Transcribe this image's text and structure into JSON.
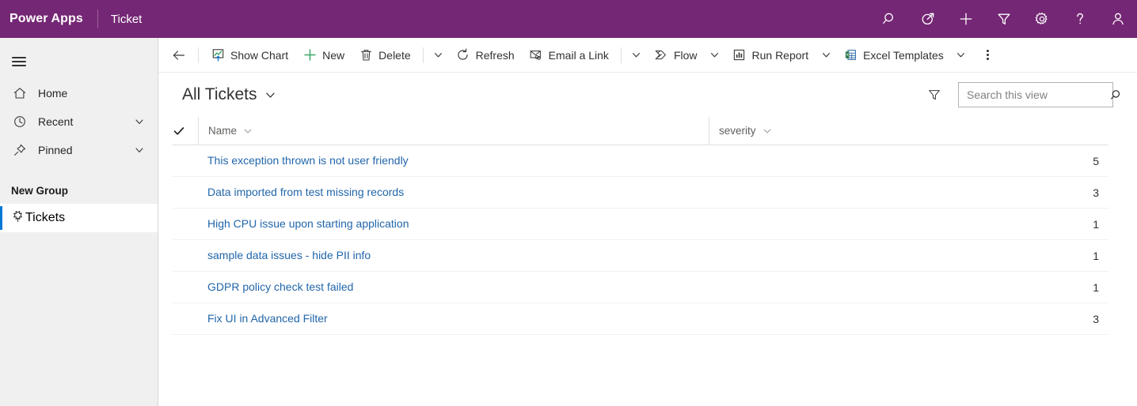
{
  "header": {
    "brand": "Power Apps",
    "app_name": "Ticket",
    "background_color": "#742774",
    "icons": [
      {
        "name": "search-icon",
        "label": "Search"
      },
      {
        "name": "diagnostics-icon",
        "label": "Diagnostics"
      },
      {
        "name": "plus-icon",
        "label": "Quick create"
      },
      {
        "name": "filter-icon",
        "label": "Filter"
      },
      {
        "name": "gear-icon",
        "label": "Settings"
      },
      {
        "name": "help-icon",
        "label": "Help"
      },
      {
        "name": "user-avatar-icon",
        "label": "Account"
      }
    ]
  },
  "sidebar": {
    "hamburger_label": "Site Map",
    "items": [
      {
        "label": "Home",
        "icon": "home-icon",
        "chevron": false
      },
      {
        "label": "Recent",
        "icon": "clock-icon",
        "chevron": true
      },
      {
        "label": "Pinned",
        "icon": "pin-icon",
        "chevron": true
      }
    ],
    "group_header": "New Group",
    "group_items": [
      {
        "label": "Tickets",
        "icon": "puzzle-icon",
        "selected": true
      }
    ],
    "selected_indicator_color": "#0078d4"
  },
  "command_bar": {
    "back_label": "Back",
    "buttons": [
      {
        "label": "Show Chart",
        "icon": "show-chart-icon",
        "caret": false
      },
      {
        "label": "New",
        "icon": "plus-icon",
        "caret": false
      },
      {
        "label": "Delete",
        "icon": "trash-icon",
        "caret": true
      },
      {
        "label": "Refresh",
        "icon": "refresh-icon",
        "caret": false
      },
      {
        "label": "Email a Link",
        "icon": "email-link-icon",
        "caret": true
      },
      {
        "label": "Flow",
        "icon": "flow-icon",
        "caret": true
      },
      {
        "label": "Run Report",
        "icon": "report-icon",
        "caret": true
      },
      {
        "label": "Excel Templates",
        "icon": "excel-icon",
        "caret": true
      }
    ],
    "overflow_label": "More commands"
  },
  "view_bar": {
    "view_title": "All Tickets",
    "filter_label": "Filter by",
    "search": {
      "placeholder": "Search this view",
      "value": "",
      "icon": "search-icon"
    }
  },
  "grid": {
    "select_all_label": "Select all",
    "columns": [
      {
        "label": "Name",
        "key": "name"
      },
      {
        "label": "severity",
        "key": "severity"
      }
    ],
    "rows": [
      {
        "name": "This exception thrown is not user friendly",
        "severity": "5"
      },
      {
        "name": "Data imported from test missing records",
        "severity": "3"
      },
      {
        "name": "High CPU issue upon starting application",
        "severity": "1"
      },
      {
        "name": "sample data issues - hide PII info",
        "severity": "1"
      },
      {
        "name": "GDPR policy check test failed",
        "severity": "1"
      },
      {
        "name": "Fix UI in Advanced Filter",
        "severity": "3"
      }
    ],
    "link_color": "#2266aa"
  }
}
